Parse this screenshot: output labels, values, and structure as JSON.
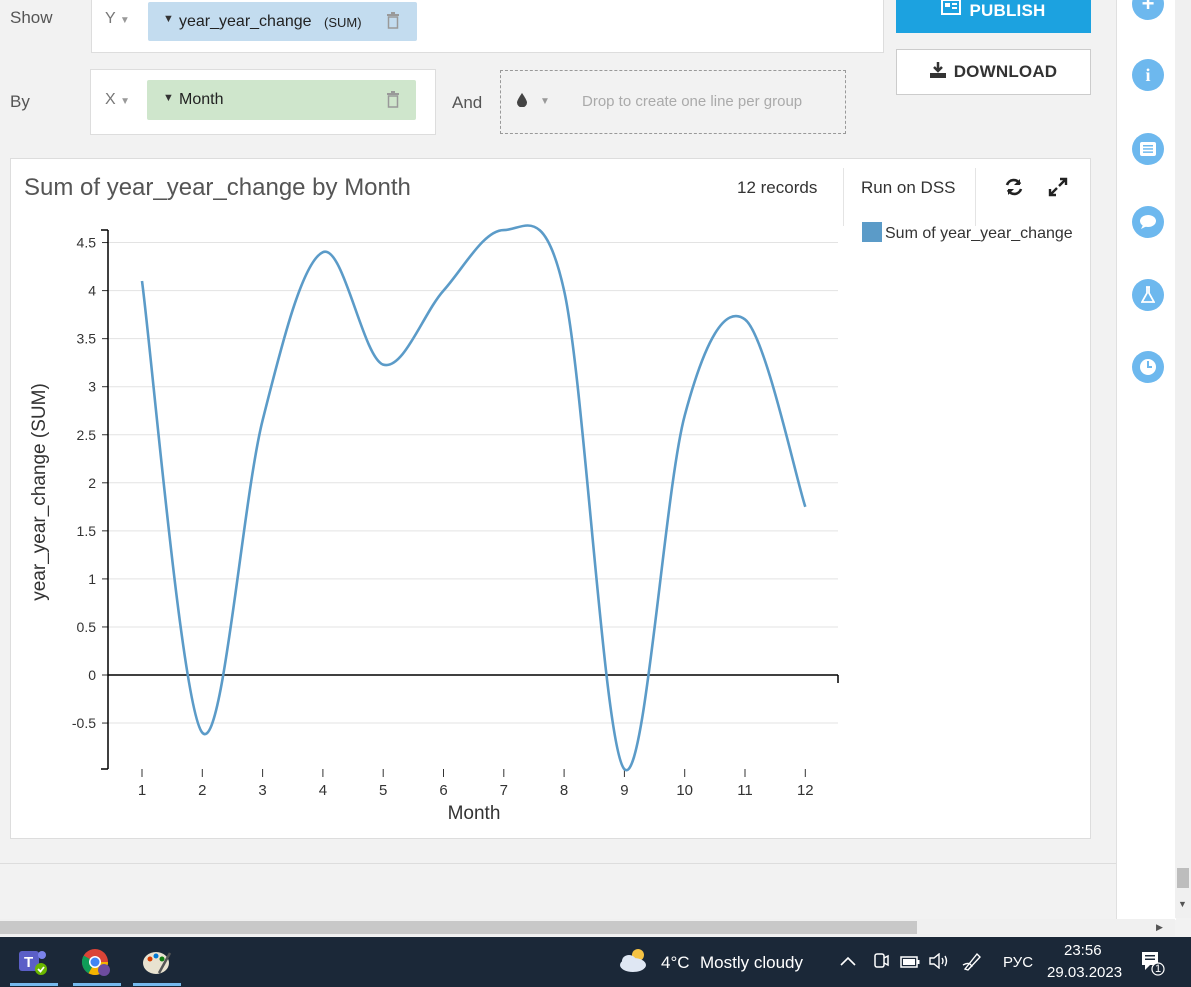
{
  "controls": {
    "show_label": "Show",
    "by_label": "By",
    "and_label": "And",
    "y_axis": "Y",
    "x_axis": "X",
    "y_chip": "year_year_change",
    "y_chip_agg": "(SUM)",
    "x_chip": "Month",
    "group_placeholder": "Drop to create one line per group"
  },
  "actions": {
    "publish": "PUBLISH",
    "download": "DOWNLOAD"
  },
  "chart_header": {
    "title": "Sum of year_year_change by Month",
    "records": "12 records",
    "run": "Run on DSS"
  },
  "chart_data": {
    "type": "line",
    "title": "Sum of year_year_change by Month",
    "xlabel": "Month",
    "ylabel": "year_year_change (SUM)",
    "categories": [
      "1",
      "2",
      "3",
      "4",
      "5",
      "6",
      "7",
      "8",
      "9",
      "10",
      "11",
      "12"
    ],
    "series": [
      {
        "name": "Sum of year_year_change",
        "values": [
          4.1,
          -0.6,
          2.65,
          4.4,
          3.23,
          4.0,
          4.63,
          4.0,
          -0.98,
          2.7,
          3.7,
          1.75
        ]
      }
    ],
    "ylim": [
      -0.98,
      4.63
    ],
    "yticks": [
      "4.5",
      "4",
      "3.5",
      "3",
      "2.5",
      "2",
      "1.5",
      "1",
      "0.5",
      "0",
      "-0.5"
    ],
    "legend": "top-right",
    "grid": true,
    "color": "#5b9bc8"
  },
  "sidebar_icons": [
    "plus-icon",
    "info-icon",
    "list-icon",
    "comment-icon",
    "flask-icon",
    "clock-icon"
  ],
  "taskbar": {
    "weather_temp": "4°C",
    "weather_text": "Mostly cloudy",
    "lang": "РУС",
    "time": "23:56",
    "date": "29.03.2023",
    "notif_count": "1"
  }
}
